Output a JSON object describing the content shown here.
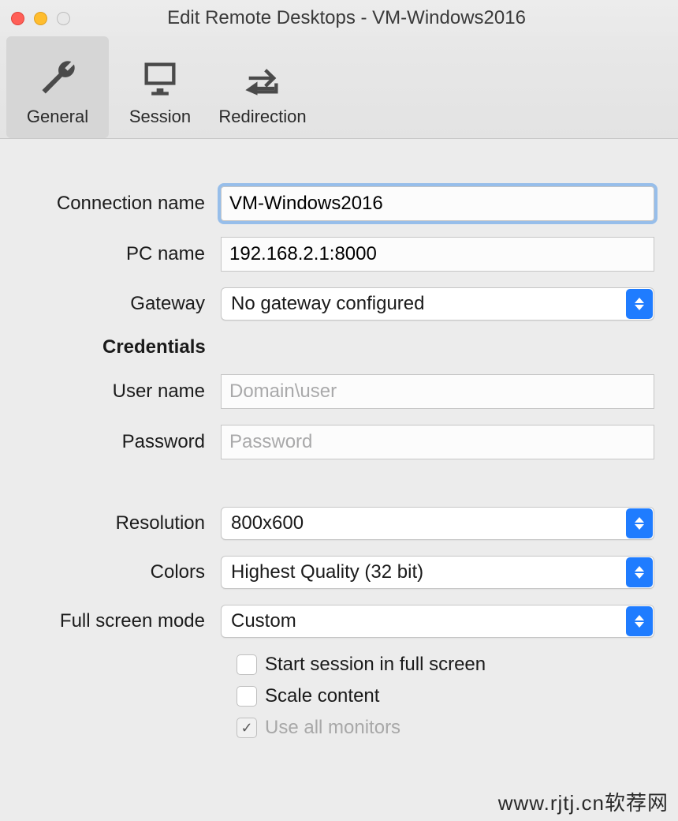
{
  "window": {
    "title": "Edit Remote Desktops - VM-Windows2016"
  },
  "tabs": {
    "general": "General",
    "session": "Session",
    "redirection": "Redirection"
  },
  "labels": {
    "connection_name": "Connection name",
    "pc_name": "PC name",
    "gateway": "Gateway",
    "credentials": "Credentials",
    "user_name": "User name",
    "password": "Password",
    "resolution": "Resolution",
    "colors": "Colors",
    "full_screen_mode": "Full screen mode"
  },
  "values": {
    "connection_name": "VM-Windows2016",
    "pc_name": "192.168.2.1:8000",
    "gateway": "No gateway configured",
    "user_name_placeholder": "Domain\\user",
    "password_placeholder": "Password",
    "resolution": "800x600",
    "colors": "Highest Quality (32 bit)",
    "full_screen_mode": "Custom"
  },
  "checkboxes": {
    "start_full_screen": "Start session in full screen",
    "scale_content": "Scale content",
    "use_all_monitors": "Use all monitors"
  },
  "watermark": "www.rjtj.cn软荐网"
}
